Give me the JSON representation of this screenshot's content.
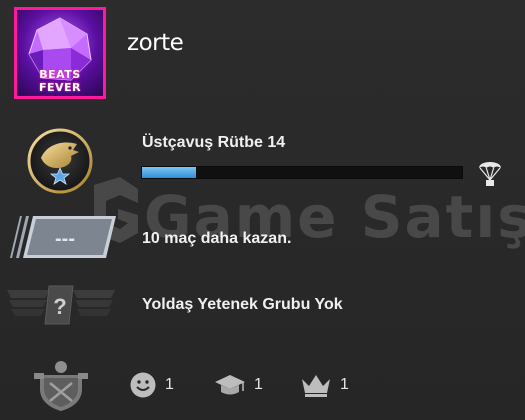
{
  "profile": {
    "username": "zorte",
    "avatar_text": "BEATS FEVER"
  },
  "rank": {
    "title": "Üstçavuş Rütbe 14",
    "progress": 0.17,
    "icon": "eagle-emblem-icon"
  },
  "competitive": {
    "status_text": "10 maç daha kazan.",
    "badge_placeholder": "---"
  },
  "skill_group": {
    "text": "Yoldaş Yetenek Grubu Yok",
    "badge_symbol": "?"
  },
  "watermark": {
    "text": "Game Satış"
  },
  "commendations": {
    "friendly": "1",
    "teacher": "1",
    "leader": "1"
  },
  "colors": {
    "accent_blue": "#2d8fd6",
    "avatar_border": "#ff1a9b"
  }
}
